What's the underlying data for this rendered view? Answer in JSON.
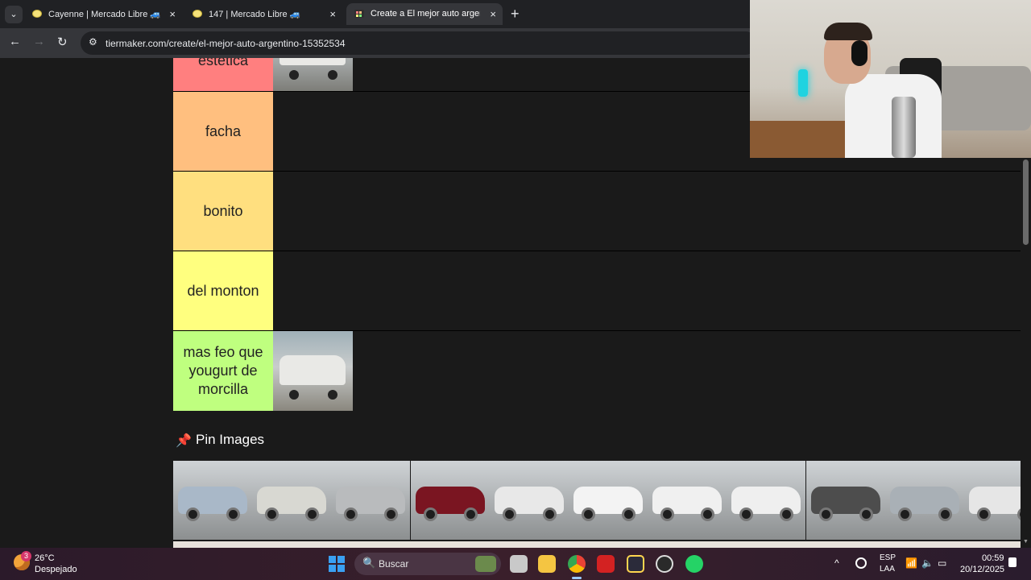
{
  "browser": {
    "tabs": [
      {
        "title": "Cayenne | Mercado Libre 🚙"
      },
      {
        "title": "147 | Mercado Libre 🚙"
      },
      {
        "title": "Create a El mejor auto argentino",
        "active": true
      }
    ],
    "new_tab": "+",
    "tab_list": "⌄",
    "close": "×",
    "nav": {
      "back": "←",
      "forward": "→",
      "reload": "↻"
    },
    "site_icon": "⚙",
    "url": "tiermaker.com/create/el-mejor-auto-argentino-15352534"
  },
  "tiers": [
    {
      "label": "estetica",
      "color": "#ff7f7f",
      "has_car": true
    },
    {
      "label": "facha",
      "color": "#ffbf7f",
      "has_car": false
    },
    {
      "label": "bonito",
      "color": "#ffdf7f",
      "has_car": false
    },
    {
      "label": "del monton",
      "color": "#ffff7f",
      "has_car": false
    },
    {
      "label": "mas feo que yougurt de morcilla",
      "color": "#bfff7f",
      "has_car": true
    }
  ],
  "pin_section": {
    "title": "Pin Images",
    "icon": "📌",
    "thumbnail_colors": [
      "#a9b8c8",
      "#d8d8d2",
      "#b9bbbd",
      "#7a1521",
      "#e8e8e8",
      "#f3f3f3",
      "#f0f0f0",
      "#efefef",
      "#4d4d4d",
      "#a9b0b6",
      "#e6e6e6"
    ]
  },
  "scroll": {
    "up": "▲",
    "down": "▼"
  },
  "taskbar": {
    "weather_temp": "26°C",
    "weather_cond": "Despejado",
    "weather_badge": "3",
    "search_icon": "🔍",
    "search_placeholder": "Buscar",
    "tray_chevron": "^",
    "lang_line1": "ESP",
    "lang_line2": "LAA",
    "wifi_icon": "📶",
    "volume_icon": "🔈",
    "battery_icon": "▭",
    "time": "00:59",
    "date": "20/12/2025"
  }
}
